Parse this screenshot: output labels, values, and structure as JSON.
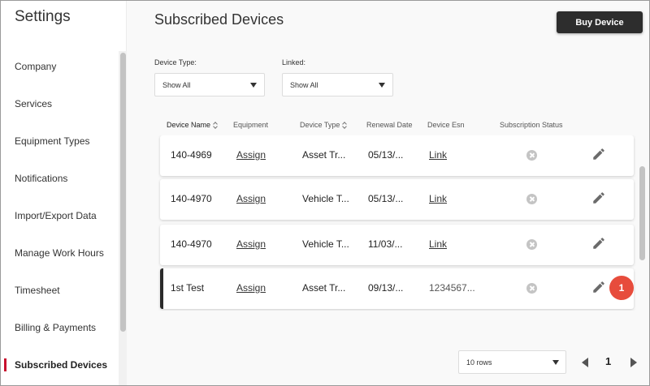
{
  "sidebar": {
    "title": "Settings",
    "items": [
      {
        "label": "Company"
      },
      {
        "label": "Services"
      },
      {
        "label": "Equipment Types"
      },
      {
        "label": "Notifications"
      },
      {
        "label": "Import/Export Data"
      },
      {
        "label": "Manage Work Hours"
      },
      {
        "label": "Timesheet"
      },
      {
        "label": "Billing & Payments"
      },
      {
        "label": "Subscribed Devices",
        "active": true
      }
    ]
  },
  "header": {
    "title": "Subscribed Devices",
    "buy_button": "Buy Device"
  },
  "filters": {
    "device_type": {
      "label": "Device Type:",
      "value": "Show All"
    },
    "linked": {
      "label": "Linked:",
      "value": "Show All"
    }
  },
  "table": {
    "columns": [
      "Device Name",
      "Equipment",
      "Device Type",
      "Renewal Date",
      "Device Esn",
      "Subscription Status"
    ],
    "rows": [
      {
        "name": "140-4969",
        "equipment": "Assign",
        "type": "Asset Tr...",
        "renewal": "05/13/...",
        "esn": "Link",
        "esn_is_link": true
      },
      {
        "name": "140-4970",
        "equipment": "Assign",
        "type": "Vehicle T...",
        "renewal": "05/13/...",
        "esn": "Link",
        "esn_is_link": true
      },
      {
        "name": "140-4970",
        "equipment": "Assign",
        "type": "Vehicle T...",
        "renewal": "11/03/...",
        "esn": "Link",
        "esn_is_link": true
      },
      {
        "name": "1st Test",
        "equipment": "Assign",
        "type": "Asset Tr...",
        "renewal": "09/13/...",
        "esn": "1234567...",
        "esn_is_link": false,
        "selected": true
      }
    ]
  },
  "badge": "1",
  "pagination": {
    "rows_per_page": "10 rows",
    "current_page": "1"
  },
  "icons": {
    "status": "cancel-circle-icon",
    "edit": "pencil-icon",
    "prev": "chevron-left-icon",
    "next": "chevron-right-icon"
  },
  "colors": {
    "accent": "#c8102e",
    "primary_button": "#2d2d2d",
    "badge": "#e74c3c"
  }
}
